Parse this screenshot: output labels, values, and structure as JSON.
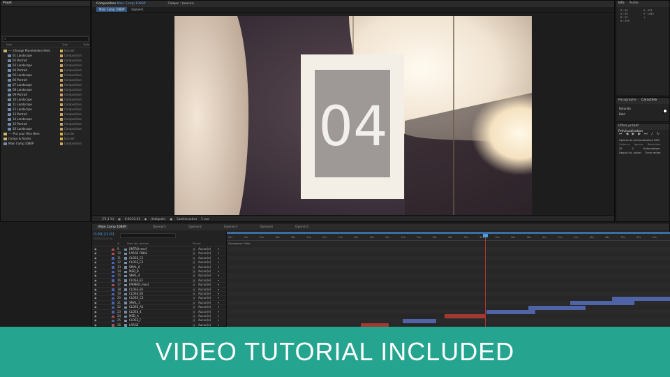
{
  "project_panel": {
    "title": "Projet",
    "columns": [
      "Nom",
      "Type",
      "Taille"
    ],
    "items": [
      {
        "name": "---- Change Placeholders Here",
        "type": "Dossier",
        "kind": "folder"
      },
      {
        "name": "01 Landscape",
        "type": "Composition",
        "kind": "comp"
      },
      {
        "name": "02 Portrait",
        "type": "Composition",
        "kind": "comp"
      },
      {
        "name": "03 Landscape",
        "type": "Composition",
        "kind": "comp"
      },
      {
        "name": "04 Portrait",
        "type": "Composition",
        "kind": "comp"
      },
      {
        "name": "05 Landscape",
        "type": "Composition",
        "kind": "comp"
      },
      {
        "name": "06 Portrait",
        "type": "Composition",
        "kind": "comp"
      },
      {
        "name": "07 Landscape",
        "type": "Composition",
        "kind": "comp"
      },
      {
        "name": "08 Landscape",
        "type": "Composition",
        "kind": "comp"
      },
      {
        "name": "09 Portrait",
        "type": "Composition",
        "kind": "comp"
      },
      {
        "name": "10 Landscape",
        "type": "Composition",
        "kind": "comp"
      },
      {
        "name": "11 Landscape",
        "type": "Composition",
        "kind": "comp"
      },
      {
        "name": "12 Landscape",
        "type": "Composition",
        "kind": "comp"
      },
      {
        "name": "13 Portrait",
        "type": "Composition",
        "kind": "comp"
      },
      {
        "name": "14 Landscape",
        "type": "Composition",
        "kind": "comp"
      },
      {
        "name": "15 Portrait",
        "type": "Composition",
        "kind": "comp"
      },
      {
        "name": "16 Landscape",
        "type": "Composition",
        "kind": "comp"
      },
      {
        "name": "---- Put your Files Here",
        "type": "Dossier",
        "kind": "folder"
      },
      {
        "name": "Comps & Assets",
        "type": "Dossier",
        "kind": "folder"
      },
      {
        "name": "Main Comp 1080P",
        "type": "Composition",
        "kind": "comp"
      }
    ]
  },
  "composition_panel": {
    "title": "Composition",
    "comp_name": "Main Comp 1080P",
    "other_tab": "Calque : (aucun)",
    "sub_tabs": [
      "Main Comp 1080P",
      "Opener1"
    ],
    "footer": {
      "zoom": "(71,1 %)",
      "timecode": "0:00:21:01",
      "quality": "(Intégrale)",
      "camera": "Caméra active",
      "views": "1 vue"
    }
  },
  "preview_frame": {
    "number": "04"
  },
  "info_panel": {
    "tabs": [
      "Info",
      "Audio"
    ],
    "lines_left": [
      "R : 59",
      "V : 55",
      "B : 52",
      "A : 255"
    ],
    "lines_right": [
      "X : 437",
      "Y : 1453",
      "+"
    ]
  },
  "typo_panel": {
    "tabs": [
      "Paragraphe",
      "Caractère"
    ],
    "font": "Rotunda",
    "style": "Bold"
  },
  "preview_panel": {
    "tabs": [
      "Effets prédéf.",
      "Prévisualisation"
    ],
    "section": "Options de prévisualisation RAM",
    "row1_labels": [
      "Cadence",
      "Ignorer",
      "Résolution"
    ],
    "row1_values": [
      "25",
      "0",
      "Automatique"
    ],
    "checks": [
      "Depuis int. actuel",
      "Écran entier"
    ]
  },
  "timeline": {
    "tabs": [
      "Main Comp 1080P",
      "Opener1",
      "Opener2",
      "Opener3",
      "Opener4",
      "Opener5"
    ],
    "timecode": "0:00:21:01",
    "frames": "00526 (25.00 i/s)",
    "col_headers": [
      "#",
      "Nom des calques",
      "Parent"
    ],
    "ruler": [
      "00s",
      "02s",
      "04s",
      "06s",
      "08s",
      "10s",
      "12s",
      "14s",
      "16s",
      "18s",
      "20s",
      "22s",
      "24s",
      "26s",
      "28s",
      "30s",
      "32s",
      "34s",
      "36s",
      "38s",
      "40s",
      "42s",
      "44s",
      "46s",
      "48s",
      "50s",
      "52s",
      "54s"
    ],
    "layers": [
      {
        "num": "9",
        "name": "[INTRO.mov]",
        "parent": "Aucun(e)",
        "color": "#b24b4b"
      },
      {
        "num": "10",
        "name": "LARGE FINAL",
        "parent": "Aucun(e)",
        "color": "#b24b4b"
      },
      {
        "num": "11",
        "name": "CLOSE_C1",
        "parent": "Aucun(e)",
        "color": "#4a63b0"
      },
      {
        "num": "12",
        "name": "CLOSE_C2",
        "parent": "Aucun(e)",
        "color": "#4a63b0"
      },
      {
        "num": "13",
        "name": "SMAL_6",
        "parent": "Aucun(e)",
        "color": "#4a63b0"
      },
      {
        "num": "14",
        "name": "MED_B",
        "parent": "Aucun(e)",
        "color": "#4a63b0"
      },
      {
        "num": "15",
        "name": "SMAL_4",
        "parent": "Aucun(e)",
        "color": "#4a63b0"
      },
      {
        "num": "16",
        "name": "CLOSE_E1",
        "parent": "Aucun(e)",
        "color": "#4a63b0"
      },
      {
        "num": "17",
        "name": "[PAPER2.mov]",
        "parent": "Aucun(e)",
        "color": "#b24b4b"
      },
      {
        "num": "18",
        "name": "CLOSE_B1",
        "parent": "Aucun(e)",
        "color": "#4a63b0"
      },
      {
        "num": "19",
        "name": "CLOSE_B2",
        "parent": "Aucun(e)",
        "color": "#4a63b0"
      },
      {
        "num": "20",
        "name": "CLOSE_C3",
        "parent": "Aucun(e)",
        "color": "#4a63b0"
      },
      {
        "num": "21",
        "name": "SMAL_1",
        "parent": "Aucun(e)",
        "color": "#4a63b0"
      },
      {
        "num": "22",
        "name": "CLOSE_A1",
        "parent": "Aucun(e)",
        "color": "#4a63b0"
      },
      {
        "num": "23",
        "name": "CLOSE_4",
        "parent": "Aucun(e)",
        "color": "#4a63b0"
      },
      {
        "num": "24",
        "name": "MED_A",
        "parent": "Aucun(e)",
        "color": "#b24b4b"
      },
      {
        "num": "25",
        "name": "CLOSE_F",
        "parent": "Aucun(e)",
        "color": "#4a63b0"
      },
      {
        "num": "26",
        "name": "LARGE",
        "parent": "Aucun(e)",
        "color": "#b24b4b"
      }
    ],
    "markers": [
      "Commencer l'intro"
    ]
  },
  "banner": {
    "text": "VIDEO TUTORIAL INCLUDED"
  },
  "colors": {
    "accent": "#25a58f",
    "timeline_blue": "#4f63a6",
    "timeline_red": "#a03a32",
    "playhead": "#c0392b"
  }
}
